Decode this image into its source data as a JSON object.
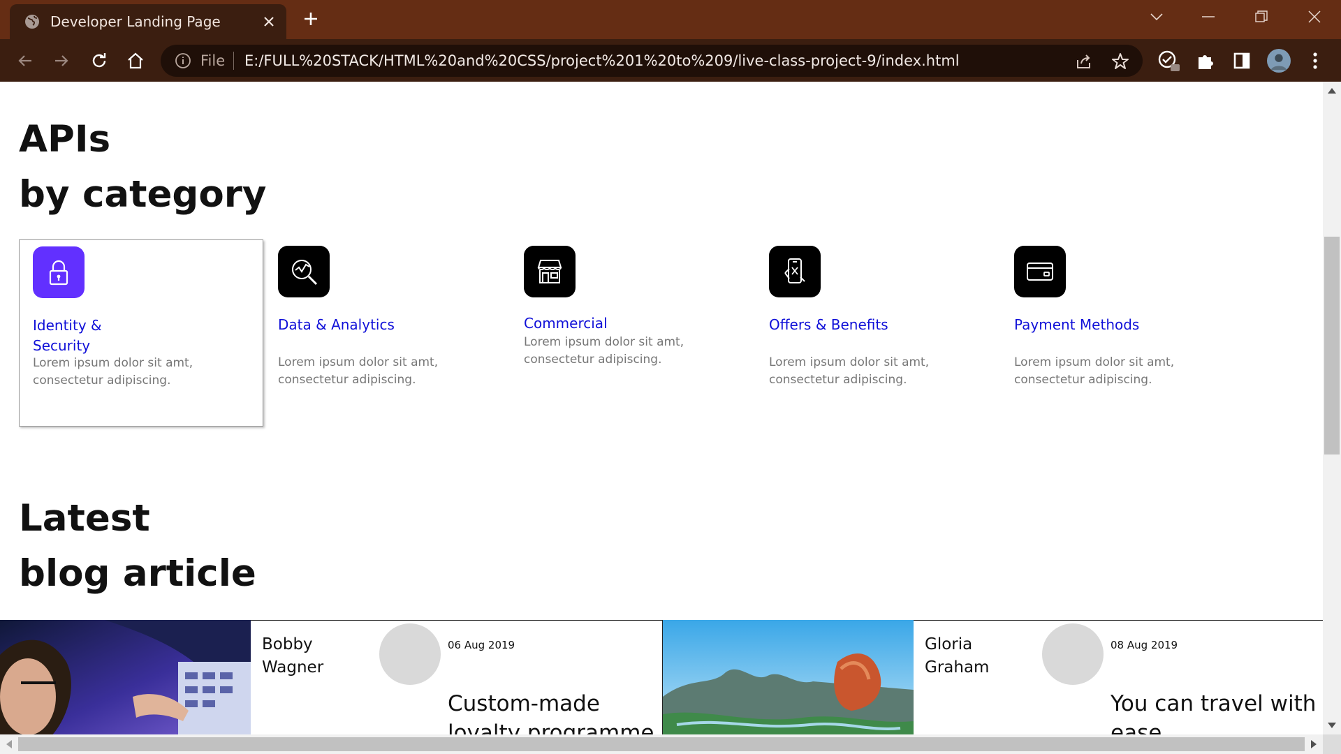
{
  "browser": {
    "tab_title": "Developer Landing Page",
    "omnibox_scheme": "File",
    "url": "E:/FULL%20STACK/HTML%20and%20CSS/project%201%20to%209/live-class-project-9/index.html"
  },
  "apis": {
    "title_line1": "APIs",
    "title_line2": "by category",
    "cards": [
      {
        "icon": "lock-icon",
        "title": "Identity & Security",
        "description": "Lorem ipsum dolor sit amt, consectetur adipiscing.",
        "active": true
      },
      {
        "icon": "magnifier-chart-icon",
        "title": "Data & Analytics",
        "description": "Lorem ipsum dolor sit amt, consectetur adipiscing.",
        "active": false
      },
      {
        "icon": "storefront-icon",
        "title": "Commercial",
        "description": "Lorem ipsum dolor sit amt, consectetur adipiscing.",
        "active": false
      },
      {
        "icon": "mobile-offer-icon",
        "title": "Offers & Benefits",
        "description": "Lorem ipsum dolor sit amt, consectetur adipiscing.",
        "active": false
      },
      {
        "icon": "credit-card-icon",
        "title": "Payment Methods",
        "description": "Lorem ipsum dolor sit amt, consectetur adipiscing.",
        "active": false
      }
    ]
  },
  "blog": {
    "title_line1": "Latest",
    "title_line2": "blog article",
    "articles": [
      {
        "author": "Bobby Wagner",
        "date": "06 Aug 2019",
        "title": "Custom-made loyalty programme"
      },
      {
        "author": "Gloria Graham",
        "date": "08 Aug 2019",
        "title": "You can travel with ease"
      }
    ]
  },
  "colors": {
    "tabbar": "#652d14",
    "toolbar": "#3b1e10",
    "link_blue": "#1010d8",
    "active_icon": "#6230ff"
  }
}
